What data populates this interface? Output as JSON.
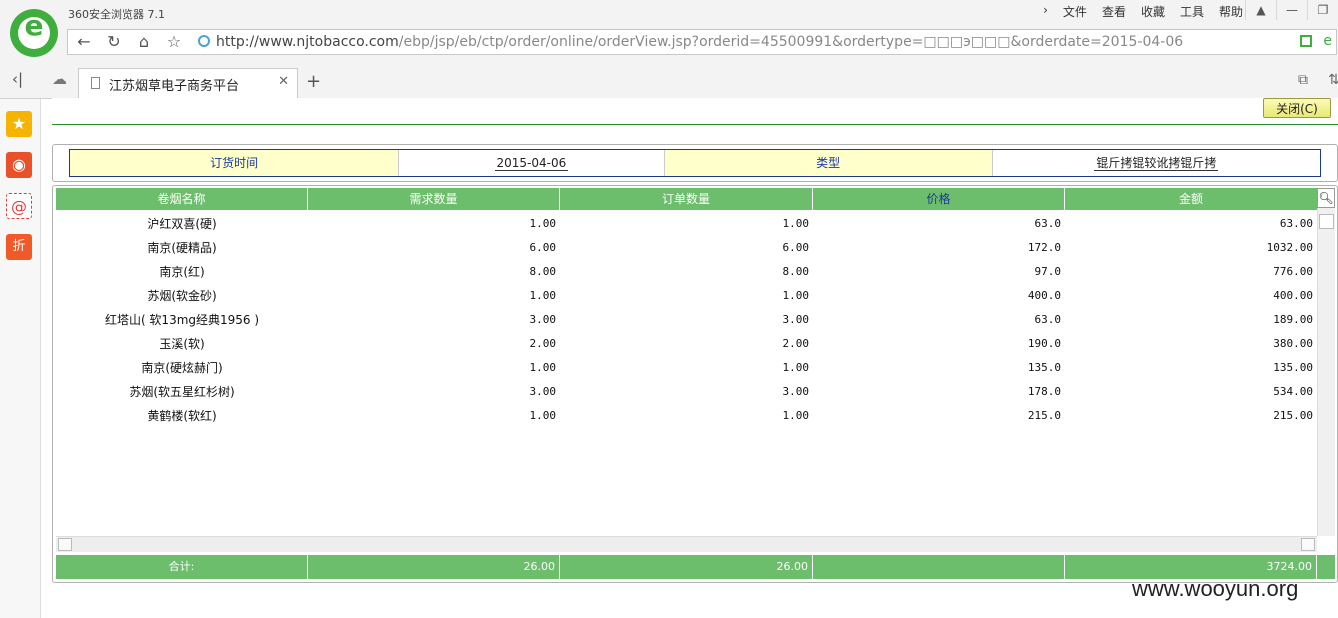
{
  "browser": {
    "app_title": "360安全浏览器 7.1",
    "menu": [
      "文件",
      "查看",
      "收藏",
      "工具",
      "帮助"
    ],
    "url_host": "http://www.njtobacco.com",
    "url_path": "/ebp/jsp/eb/ctp/order/online/orderView.jsp?orderid=45500991&ordertype=□□□э□□□&orderdate=2015-04-06",
    "tab_title": "江苏烟草电子商务平台"
  },
  "page": {
    "close_button": "关闭(C)",
    "info": {
      "order_time_label": "订货时间",
      "order_time_value": "2015-04-06",
      "type_label": "类型",
      "type_value": "锟斤拷锟较讹拷锟斤拷"
    },
    "grid": {
      "headers": [
        "卷烟名称",
        "需求数量",
        "订单数量",
        "价格",
        "金额"
      ],
      "rows": [
        {
          "name": "沪红双喜(硬)",
          "demand": "1.00",
          "order": "1.00",
          "price": "63.0",
          "amount": "63.00"
        },
        {
          "name": "南京(硬精品)",
          "demand": "6.00",
          "order": "6.00",
          "price": "172.0",
          "amount": "1032.00"
        },
        {
          "name": "南京(红)",
          "demand": "8.00",
          "order": "8.00",
          "price": "97.0",
          "amount": "776.00"
        },
        {
          "name": "苏烟(软金砂)",
          "demand": "1.00",
          "order": "1.00",
          "price": "400.0",
          "amount": "400.00"
        },
        {
          "name": "红塔山( 软13mg经典1956 )",
          "demand": "3.00",
          "order": "3.00",
          "price": "63.0",
          "amount": "189.00"
        },
        {
          "name": "玉溪(软)",
          "demand": "2.00",
          "order": "2.00",
          "price": "190.0",
          "amount": "380.00"
        },
        {
          "name": "南京(硬炫赫门)",
          "demand": "1.00",
          "order": "1.00",
          "price": "135.0",
          "amount": "135.00"
        },
        {
          "name": "苏烟(软五星红杉树)",
          "demand": "3.00",
          "order": "3.00",
          "price": "178.0",
          "amount": "534.00"
        },
        {
          "name": "黄鹤楼(软红)",
          "demand": "1.00",
          "order": "1.00",
          "price": "215.0",
          "amount": "215.00"
        }
      ],
      "footer": {
        "label": "合计:",
        "demand_total": "26.00",
        "order_total": "26.00",
        "amount_total": "3724.00"
      }
    }
  },
  "watermark": "www.wooyun.org",
  "colors": {
    "header_green": "#6cbe6c",
    "info_label_bg": "#ffffcc",
    "brand_green": "#3fae3f"
  }
}
